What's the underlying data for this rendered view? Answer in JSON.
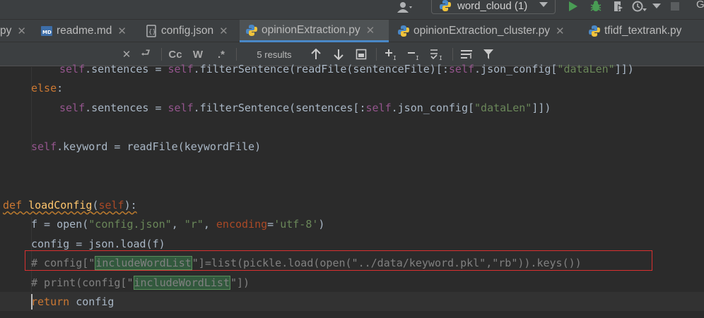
{
  "toolbar": {
    "run_config_label": "word_cloud (1)",
    "overflow_text": "G",
    "icons": [
      "user-icon",
      "python-icon",
      "run-icon",
      "debug-icon",
      "coverage-icon",
      "profile-icon",
      "stop-icon"
    ],
    "colors": {
      "run": "#499c54",
      "debug": "#499c54",
      "stop": "#5a5d5f"
    }
  },
  "tabs": [
    {
      "label": "py",
      "icon": null,
      "active": false
    },
    {
      "label": "readme.md",
      "icon": "markdown-icon",
      "active": false
    },
    {
      "label": "config.json",
      "icon": "json-icon",
      "active": false
    },
    {
      "label": "opinionExtraction.py",
      "icon": "python-icon",
      "active": true
    },
    {
      "label": "opinionExtraction_cluster.py",
      "icon": "python-icon",
      "active": false
    },
    {
      "label": "tfidf_textrank.py",
      "icon": "python-icon",
      "active": false
    }
  ],
  "find": {
    "match_case_label": "Cc",
    "words_label": "W",
    "regex_label": ".*",
    "results": "5 results"
  },
  "code": {
    "l0_self1": "self",
    "l0_mid": ".sentences = ",
    "l0_self2": "self",
    "l0_rest": ".filterSentence(readFile(sentenceFile)[:",
    "l0_self3": "self",
    "l0_tail": ".json_config[",
    "l0_str": "\"dataLen\"",
    "l0_end": "]])",
    "l1_kw": "else",
    "l1_colon": ":",
    "l2_self1": "self",
    "l2_mid": ".sentences = ",
    "l2_self2": "self",
    "l2_rest": ".filterSentence(sentences[:",
    "l2_self3": "self",
    "l2_tail": ".json_config[",
    "l2_str": "\"dataLen\"",
    "l2_end": "]])",
    "l3_self": "self",
    "l3_rest": ".keyword = readFile(keywordFile)",
    "l4_def": "def",
    "l4_name": "loadConfig",
    "l4_open": "(",
    "l4_param": "self",
    "l4_close": "):",
    "l5_a": "f = open(",
    "l5_s1": "\"config.json\"",
    "l5_b": ", ",
    "l5_s2": "\"r\"",
    "l5_c": ", ",
    "l5_kw": "encoding",
    "l5_eq": "=",
    "l5_s3": "'utf-8'",
    "l5_d": ")",
    "l6": "config = json.load(f)",
    "l7_a": "# config[\"",
    "l7_m": "includeWordList",
    "l7_b": "\"]=list(pickle.load(open(\"../data/keyword.pkl\",\"rb\")).keys())",
    "l8_a": "# print(config[\"",
    "l8_m": "includeWordList",
    "l8_b": "\"])",
    "l9_kw": "return",
    "l9_rest": " config"
  }
}
